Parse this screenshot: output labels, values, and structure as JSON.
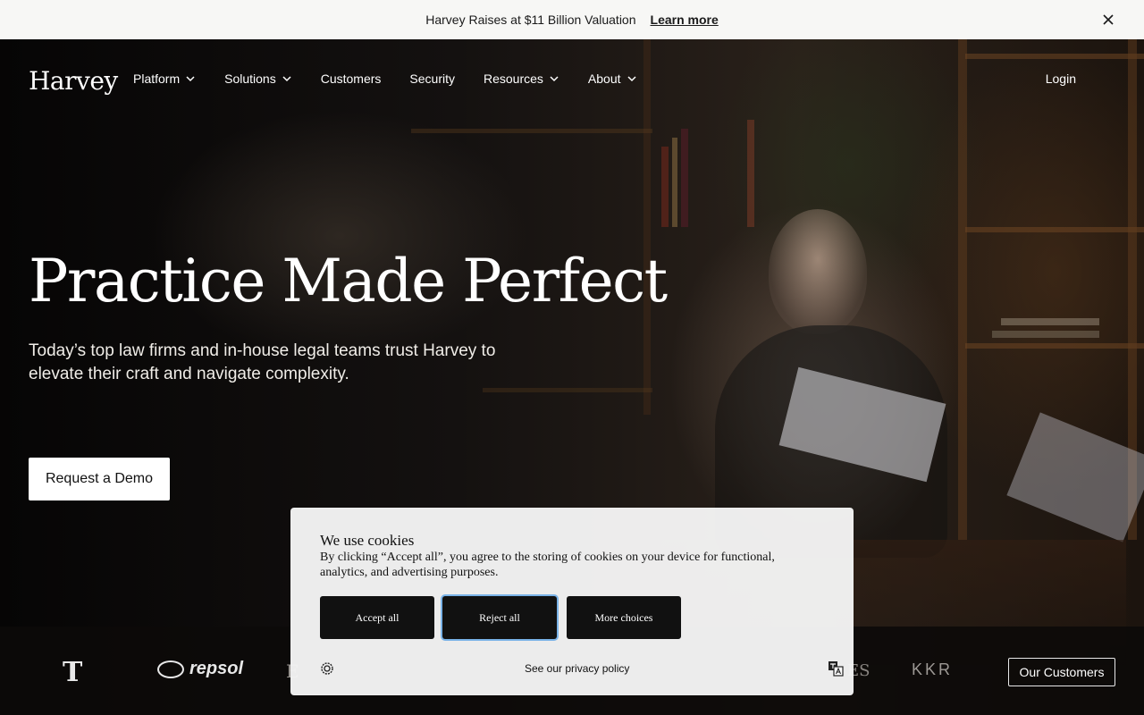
{
  "announcement": {
    "text": "Harvey Raises at $11 Billion Valuation",
    "link": "Learn more",
    "close_icon": "close-icon"
  },
  "nav": {
    "logo": "Harvey",
    "items": [
      {
        "label": "Platform",
        "has_dropdown": true
      },
      {
        "label": "Solutions",
        "has_dropdown": true
      },
      {
        "label": "Customers",
        "has_dropdown": false
      },
      {
        "label": "Security",
        "has_dropdown": false
      },
      {
        "label": "Resources",
        "has_dropdown": true
      },
      {
        "label": "About",
        "has_dropdown": true
      }
    ],
    "login": "Login"
  },
  "hero": {
    "headline": "Practice Made Perfect",
    "subhead": "Today’s top law firms and in-house legal teams trust Harvey to elevate their craft and navigate complexity.",
    "cta": "Request a Demo"
  },
  "logos": {
    "items": [
      {
        "name": "T-Mobile",
        "text": "T"
      },
      {
        "name": "Repsol",
        "text": "repsol"
      },
      {
        "name": "partially-hidden-logo",
        "text": "E"
      },
      {
        "name": "partially-hidden-logo-es",
        "text": "ES"
      },
      {
        "name": "KKR",
        "text": "KKR"
      }
    ],
    "button": "Our Customers"
  },
  "cookie_banner": {
    "title": "We use cookies",
    "body": "By clicking “Accept all”, you agree to the storing of cookies on your device for functional, analytics, and advertising purposes.",
    "accept": "Accept all",
    "reject": "Reject all",
    "more": "More choices",
    "privacy_link": "See our privacy policy",
    "focus_color": "#7ab3e8"
  }
}
